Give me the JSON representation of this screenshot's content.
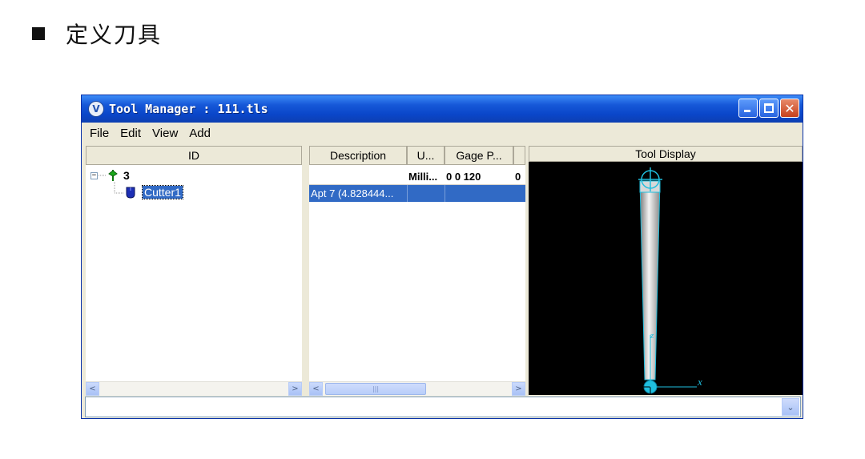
{
  "heading": {
    "text": "定义刀具"
  },
  "window": {
    "title": "Tool Manager : 111.tls",
    "app_icon": "V",
    "icons": [
      "app-logo-icon",
      "minimize-icon",
      "maximize-icon",
      "close-icon"
    ],
    "close_glyph": "✕"
  },
  "menu": {
    "file": "File",
    "edit": "Edit",
    "view": "View",
    "add": "Add"
  },
  "id_pane": {
    "header": "ID",
    "expander": "−",
    "group": "3",
    "cutter": "Cutter1",
    "icons": [
      "tool-group-icon",
      "cutter-icon"
    ]
  },
  "table": {
    "headers": [
      "Description",
      "U...",
      "Gage P...",
      ""
    ],
    "rows": [
      [
        "",
        "Milli...",
        "0 0 120",
        "0"
      ],
      [
        "Apt 7 (4.828444...",
        "",
        "",
        ""
      ]
    ]
  },
  "display": {
    "header": "Tool Display",
    "axis_x": "x",
    "axis_z": "z",
    "background": "#000000",
    "tool_color": "#d8d8d8",
    "axis_color": "#1fbfdf"
  },
  "scroll": {
    "left": "<",
    "right": ">",
    "thumb": "|||"
  },
  "statusbar": {
    "dropdown": "⌄"
  },
  "colors": {
    "title_blue": "#0a46c9",
    "selection": "#316ac5",
    "window_bg": "#ece9d8"
  }
}
